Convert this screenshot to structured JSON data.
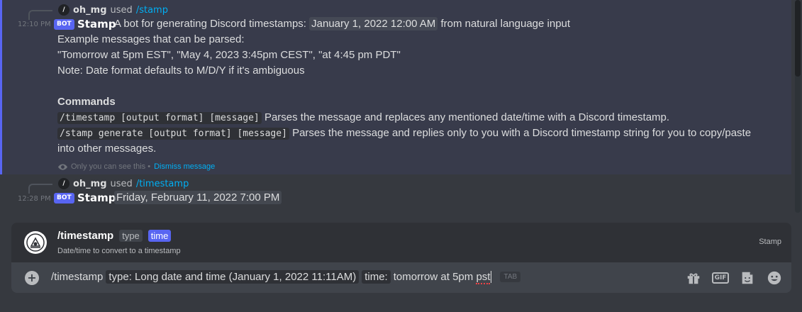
{
  "message1": {
    "reply": {
      "user": "oh_mg",
      "used": "used",
      "command": "/stamp"
    },
    "time": "12:10 PM",
    "bot_tag": "BOT",
    "author": "Stamp",
    "intro_before": "A bot for generating Discord timestamps:",
    "intro_timestamp": "January 1, 2022 12:00 AM",
    "intro_after": "from natural language input",
    "line2": "Example messages that can be parsed:",
    "line3": "\"Tomorrow at 5pm EST\", \"May 4, 2023 3:45pm CEST\", \"at 4:45 pm PDT\"",
    "line4": "Note: Date format defaults to M/D/Y if it's ambiguous",
    "commands_heading": "Commands",
    "cmd1_code": "/timestamp [output format] [message]",
    "cmd1_desc": "Parses the message and replaces any mentioned date/time with a Discord timestamp.",
    "cmd2_code": "/stamp generate [output format] [message]",
    "cmd2_desc": "Parses the message and replies only to you with a Discord timestamp string for you to copy/paste",
    "cmd2_desc_cont": "into other messages.",
    "ephemeral_note": "Only you can see this •",
    "dismiss": "Dismiss message"
  },
  "message2": {
    "reply": {
      "user": "oh_mg",
      "used": "used",
      "command": "/timestamp"
    },
    "time": "12:28 PM",
    "bot_tag": "BOT",
    "author": "Stamp",
    "timestamp_value": "Friday, February 11, 2022 7:00 PM"
  },
  "autocomplete": {
    "command": "/timestamp",
    "options": [
      "type",
      "time"
    ],
    "description": "Date/time to convert to a timestamp",
    "source": "Stamp"
  },
  "input": {
    "command": "/timestamp",
    "param1": "type: Long date and time (January 1, 2022 11:11AM)",
    "param2_label": "time:",
    "typed_before": "tomorrow at 5pm ",
    "typed_misspelled": "pst",
    "tab_hint": "TAB"
  },
  "icons": {
    "gift": "gift-icon",
    "gif": "GIF",
    "sticker": "sticker-icon",
    "emoji": "emoji-icon"
  },
  "colors": {
    "background": "#36393f",
    "blurple": "#5865f2",
    "link": "#00aff4"
  }
}
